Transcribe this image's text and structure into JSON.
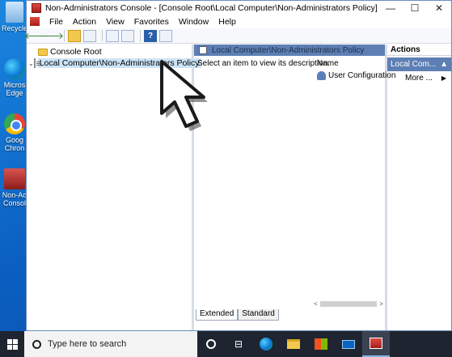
{
  "desktop": {
    "icons": [
      {
        "name": "recycle-bin",
        "label": "Recycle"
      },
      {
        "name": "edge",
        "label": "Micros",
        "label2": "Edge"
      },
      {
        "name": "chrome",
        "label": "Goog",
        "label2": "Chron"
      },
      {
        "name": "non-admin-console",
        "label": "Non-Ad",
        "label2": "Consol"
      }
    ]
  },
  "window": {
    "title": "Non-Administrators Console - [Console Root\\Local Computer\\Non-Administrators Policy]",
    "controls": {
      "minimize": "—",
      "maximize": "☐",
      "close": "✕"
    }
  },
  "menu": [
    "File",
    "Action",
    "View",
    "Favorites",
    "Window",
    "Help"
  ],
  "toolbar": {
    "back": "🡐",
    "forward": "🡒",
    "help": "?"
  },
  "tree": {
    "root": "Console Root",
    "child": "Local Computer\\Non-Administrators Policy",
    "expand_glyph": "⌄"
  },
  "center": {
    "header": "Local Computer\\Non-Administrators Policy",
    "description": "Select an item to view its description.",
    "column_name": "Name",
    "items": [
      "User Configuration"
    ],
    "tabs": [
      "Extended",
      "Standard"
    ],
    "scroll_left": "<",
    "scroll_right": ">"
  },
  "actions": {
    "header": "Actions",
    "selected": "Local Com...",
    "selected_arrow": "▲",
    "more": "More ...",
    "more_arrow": "▶"
  },
  "taskbar": {
    "search_placeholder": "Type here to search"
  },
  "colors": {
    "desktop": "#0b5fc0",
    "header_blue": "#5d7fb3",
    "taskbar": "#1f2530"
  }
}
